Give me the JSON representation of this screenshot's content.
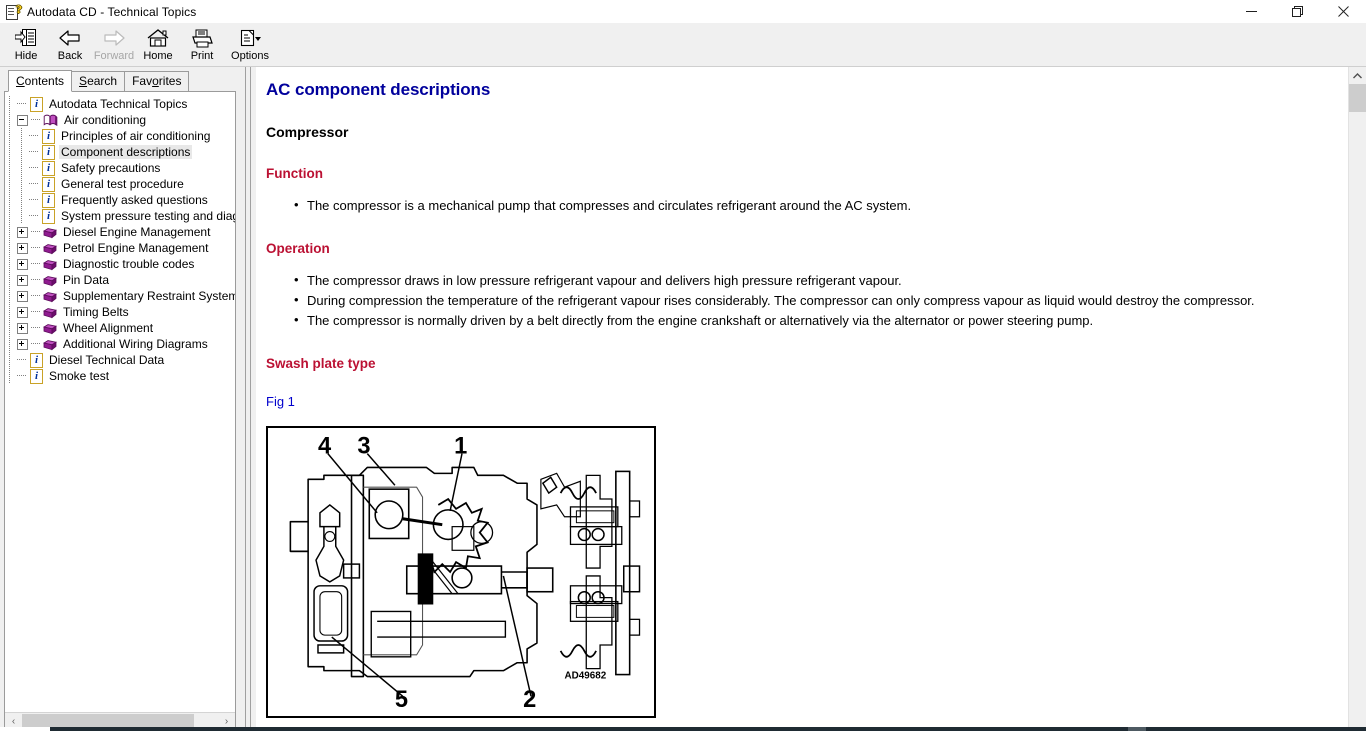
{
  "window": {
    "title": "Autodata CD - Technical Topics",
    "icon": "help-document-icon",
    "minimize_label": "—",
    "restore_label": "❐",
    "close_label": "✕"
  },
  "toolbar": {
    "buttons": [
      {
        "label": "Hide",
        "icon": "hide-pane-icon",
        "enabled": true
      },
      {
        "label": "Back",
        "icon": "back-arrow-icon",
        "enabled": true
      },
      {
        "label": "Forward",
        "icon": "forward-arrow-icon",
        "enabled": false
      },
      {
        "label": "Home",
        "icon": "home-icon",
        "enabled": true
      },
      {
        "label": "Print",
        "icon": "printer-icon",
        "enabled": true
      },
      {
        "label": "Options",
        "icon": "options-icon",
        "enabled": true
      }
    ]
  },
  "sidebar": {
    "tabs": [
      {
        "label": "Contents",
        "accel": "C",
        "active": true
      },
      {
        "label": "Search",
        "accel": "S",
        "active": false
      },
      {
        "label": "Favorites",
        "accel": "o",
        "active": false
      }
    ],
    "tree": [
      {
        "label": "Autodata Technical Topics",
        "icon": "info-page-icon",
        "depth": 1,
        "expander": "none",
        "selected": false
      },
      {
        "label": "Air conditioning",
        "icon": "open-book-icon",
        "depth": 0,
        "expander": "minus",
        "selected": false
      },
      {
        "label": "Principles of air conditioning",
        "icon": "info-page-icon",
        "depth": 2,
        "expander": "none",
        "selected": false
      },
      {
        "label": "Component descriptions",
        "icon": "info-page-icon",
        "depth": 2,
        "expander": "none",
        "selected": true
      },
      {
        "label": "Safety precautions",
        "icon": "info-page-icon",
        "depth": 2,
        "expander": "none",
        "selected": false
      },
      {
        "label": "General test procedure",
        "icon": "info-page-icon",
        "depth": 2,
        "expander": "none",
        "selected": false
      },
      {
        "label": "Frequently asked questions",
        "icon": "info-page-icon",
        "depth": 2,
        "expander": "none",
        "selected": false
      },
      {
        "label": "System pressure testing and diagr",
        "icon": "info-page-icon",
        "depth": 2,
        "expander": "none",
        "selected": false
      },
      {
        "label": "Diesel Engine Management",
        "icon": "closed-book-icon",
        "depth": 0,
        "expander": "plus",
        "selected": false
      },
      {
        "label": "Petrol Engine Management",
        "icon": "closed-book-icon",
        "depth": 0,
        "expander": "plus",
        "selected": false
      },
      {
        "label": "Diagnostic trouble codes",
        "icon": "closed-book-icon",
        "depth": 0,
        "expander": "plus",
        "selected": false
      },
      {
        "label": "Pin Data",
        "icon": "closed-book-icon",
        "depth": 0,
        "expander": "plus",
        "selected": false
      },
      {
        "label": "Supplementary Restraint Systems",
        "icon": "closed-book-icon",
        "depth": 0,
        "expander": "plus",
        "selected": false
      },
      {
        "label": "Timing Belts",
        "icon": "closed-book-icon",
        "depth": 0,
        "expander": "plus",
        "selected": false
      },
      {
        "label": "Wheel Alignment",
        "icon": "closed-book-icon",
        "depth": 0,
        "expander": "plus",
        "selected": false
      },
      {
        "label": "Additional Wiring Diagrams",
        "icon": "closed-book-icon",
        "depth": 0,
        "expander": "plus",
        "selected": false
      },
      {
        "label": "Diesel Technical Data",
        "icon": "info-page-icon",
        "depth": 1,
        "expander": "none",
        "selected": false
      },
      {
        "label": "Smoke test",
        "icon": "info-page-icon",
        "depth": 1,
        "expander": "none",
        "selected": false
      }
    ],
    "hscroll": {
      "left_arrow": "‹",
      "right_arrow": "›"
    }
  },
  "content": {
    "title": "AC component descriptions",
    "subtitle": "Compressor",
    "sections": [
      {
        "heading": "Function",
        "bullets": [
          "The compressor is a mechanical pump that compresses and circulates refrigerant around the AC system."
        ]
      },
      {
        "heading": "Operation",
        "bullets": [
          "The compressor draws in low pressure refrigerant vapour and delivers high pressure refrigerant vapour.",
          "During compression the temperature of the refrigerant vapour rises considerably. The compressor can only compress vapour as liquid would destroy the compressor.",
          "The compressor is normally driven by a belt directly from the engine crankshaft or alternatively via the alternator or power steering pump."
        ]
      }
    ],
    "swash_heading": "Swash plate type",
    "figure": {
      "caption": "Fig 1",
      "reference_code": "AD49682",
      "callouts": [
        "4",
        "3",
        "1",
        "5",
        "2"
      ]
    },
    "scroll": {
      "up_arrow": "▲",
      "down_arrow": "▼"
    }
  },
  "colors": {
    "title_blue": "#00009c",
    "section_red": "#bb1133",
    "link_blue": "#0000cc",
    "chrome_gray": "#f0f0f0",
    "book_purple": "#9b1f9b"
  }
}
